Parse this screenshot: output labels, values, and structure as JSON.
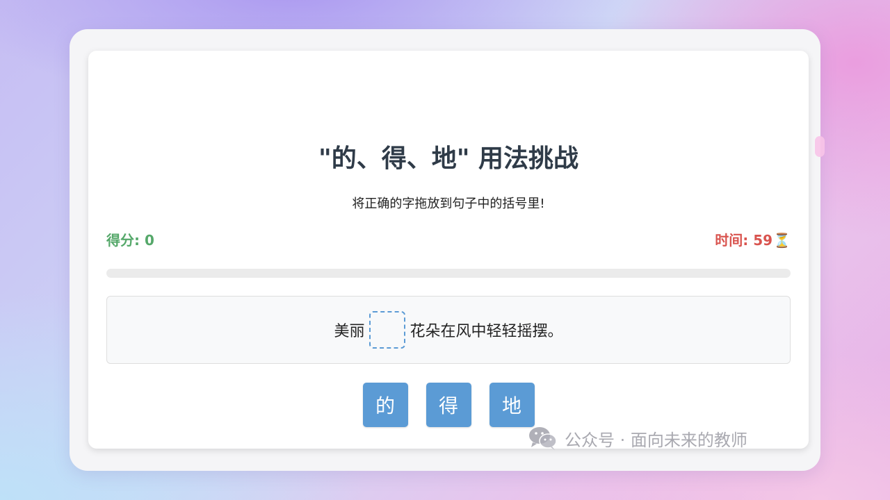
{
  "game": {
    "title": "\"的、得、地\" 用法挑战",
    "instruction": "将正确的字拖放到句子中的括号里!",
    "score_label": "得分: 0",
    "score_value": 0,
    "timer_label": "时间: 59",
    "timer_value": 59,
    "timer_icon": "⏳",
    "progress": 0,
    "sentence_before": "美丽",
    "sentence_after": "花朵在风中轻轻摇摆。",
    "blank": "",
    "options": [
      "的",
      "得",
      "地"
    ]
  },
  "watermark": {
    "text": "公众号 · 面向未来的教师",
    "icon": "wechat-icon"
  },
  "colors": {
    "accent": "#5b9bd5",
    "score": "#55a86a",
    "timer": "#d9544f",
    "title": "#2f3b48"
  }
}
